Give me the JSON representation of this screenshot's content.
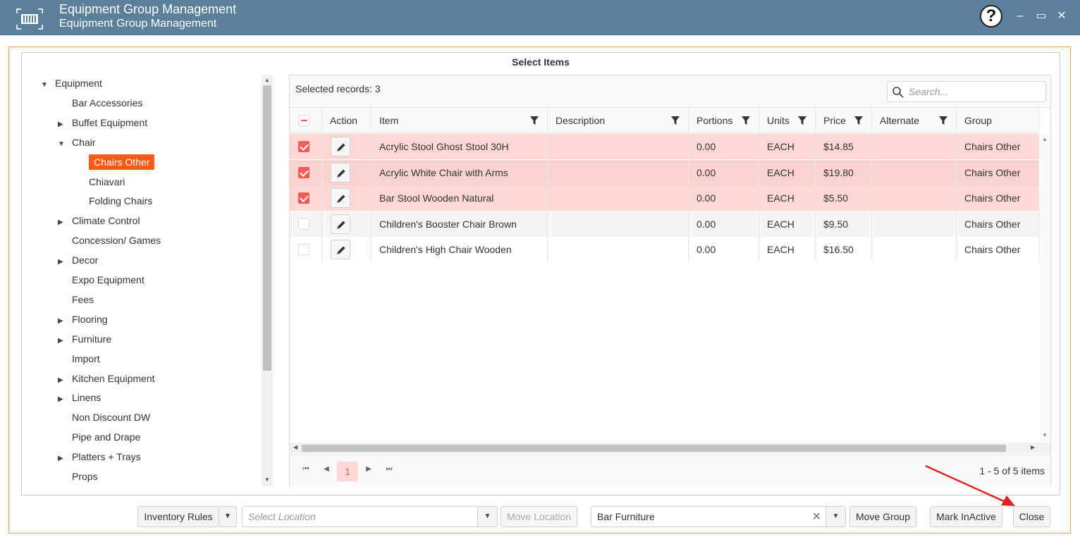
{
  "window": {
    "title": "Equipment Group Management",
    "subtitle": "Equipment Group Management",
    "help_label": "?",
    "minimize_label": "–",
    "maximize_label": "▭",
    "close_label": "✕"
  },
  "panel": {
    "title": "Select Items"
  },
  "tree": {
    "items": [
      {
        "label": "Equipment",
        "toggle": "▼",
        "level": 0
      },
      {
        "label": "Bar Accessories",
        "toggle": "",
        "level": 1
      },
      {
        "label": "Buffet Equipment",
        "toggle": "▶",
        "level": 1
      },
      {
        "label": "Chair",
        "toggle": "▼",
        "level": 1
      },
      {
        "label": "Chairs Other",
        "toggle": "",
        "level": 2,
        "selected": true
      },
      {
        "label": "Chiavari",
        "toggle": "",
        "level": 2
      },
      {
        "label": "Folding Chairs",
        "toggle": "",
        "level": 2
      },
      {
        "label": "Climate Control",
        "toggle": "▶",
        "level": 1
      },
      {
        "label": "Concession/ Games",
        "toggle": "",
        "level": 1
      },
      {
        "label": "Decor",
        "toggle": "▶",
        "level": 1
      },
      {
        "label": "Expo Equipment",
        "toggle": "",
        "level": 1
      },
      {
        "label": "Fees",
        "toggle": "",
        "level": 1
      },
      {
        "label": "Flooring",
        "toggle": "▶",
        "level": 1
      },
      {
        "label": "Furniture",
        "toggle": "▶",
        "level": 1
      },
      {
        "label": "Import",
        "toggle": "",
        "level": 1
      },
      {
        "label": "Kitchen Equipment",
        "toggle": "▶",
        "level": 1
      },
      {
        "label": "Linens",
        "toggle": "▶",
        "level": 1
      },
      {
        "label": "Non Discount DW",
        "toggle": "",
        "level": 1
      },
      {
        "label": "Pipe and Drape",
        "toggle": "",
        "level": 1
      },
      {
        "label": "Platters + Trays",
        "toggle": "▶",
        "level": 1
      },
      {
        "label": "Props",
        "toggle": "",
        "level": 1
      }
    ]
  },
  "grid": {
    "selected_text": "Selected records: 3",
    "search_placeholder": "Search...",
    "columns": {
      "action": "Action",
      "item": "Item",
      "description": "Description",
      "portions": "Portions",
      "units": "Units",
      "price": "Price",
      "alternate": "Alternate",
      "group": "Group"
    },
    "rows": [
      {
        "checked": true,
        "item": "Acrylic Stool Ghost Stool 30H",
        "description": "",
        "portions": "0.00",
        "units": "EACH",
        "price": "$14.85",
        "alternate": "",
        "group": "Chairs Other"
      },
      {
        "checked": true,
        "item": "Acrylic White Chair with Arms",
        "description": "",
        "portions": "0.00",
        "units": "EACH",
        "price": "$19.80",
        "alternate": "",
        "group": "Chairs Other"
      },
      {
        "checked": true,
        "item": "Bar Stool Wooden Natural",
        "description": "",
        "portions": "0.00",
        "units": "EACH",
        "price": "$5.50",
        "alternate": "",
        "group": "Chairs Other"
      },
      {
        "checked": false,
        "item": "Children's Booster Chair Brown",
        "description": "",
        "portions": "0.00",
        "units": "EACH",
        "price": "$9.50",
        "alternate": "",
        "group": "Chairs Other"
      },
      {
        "checked": false,
        "item": "Children's High Chair Wooden",
        "description": "",
        "portions": "0.00",
        "units": "EACH",
        "price": "$16.50",
        "alternate": "",
        "group": "Chairs Other"
      }
    ],
    "pager": {
      "current_page": "1",
      "info": "1 - 5 of 5 items",
      "first": "⏮",
      "prev": "◀",
      "next": "▶",
      "last": "⏭"
    }
  },
  "footer": {
    "inventory_rules_label": "Inventory Rules",
    "location_placeholder": "Select Location",
    "move_location_label": "Move Location",
    "group_value": "Bar Furniture",
    "move_group_label": "Move Group",
    "mark_inactive_label": "Mark InActive",
    "close_label": "Close",
    "dropdown_glyph": "▼",
    "clear_glyph": "✕"
  },
  "colors": {
    "titlebar": "#5b8099",
    "selected_tree": "#ff5a14",
    "selected_row": "#ffd8d6",
    "checkbox_on": "#f25c54",
    "annotation_arrow": "#e0201c"
  }
}
